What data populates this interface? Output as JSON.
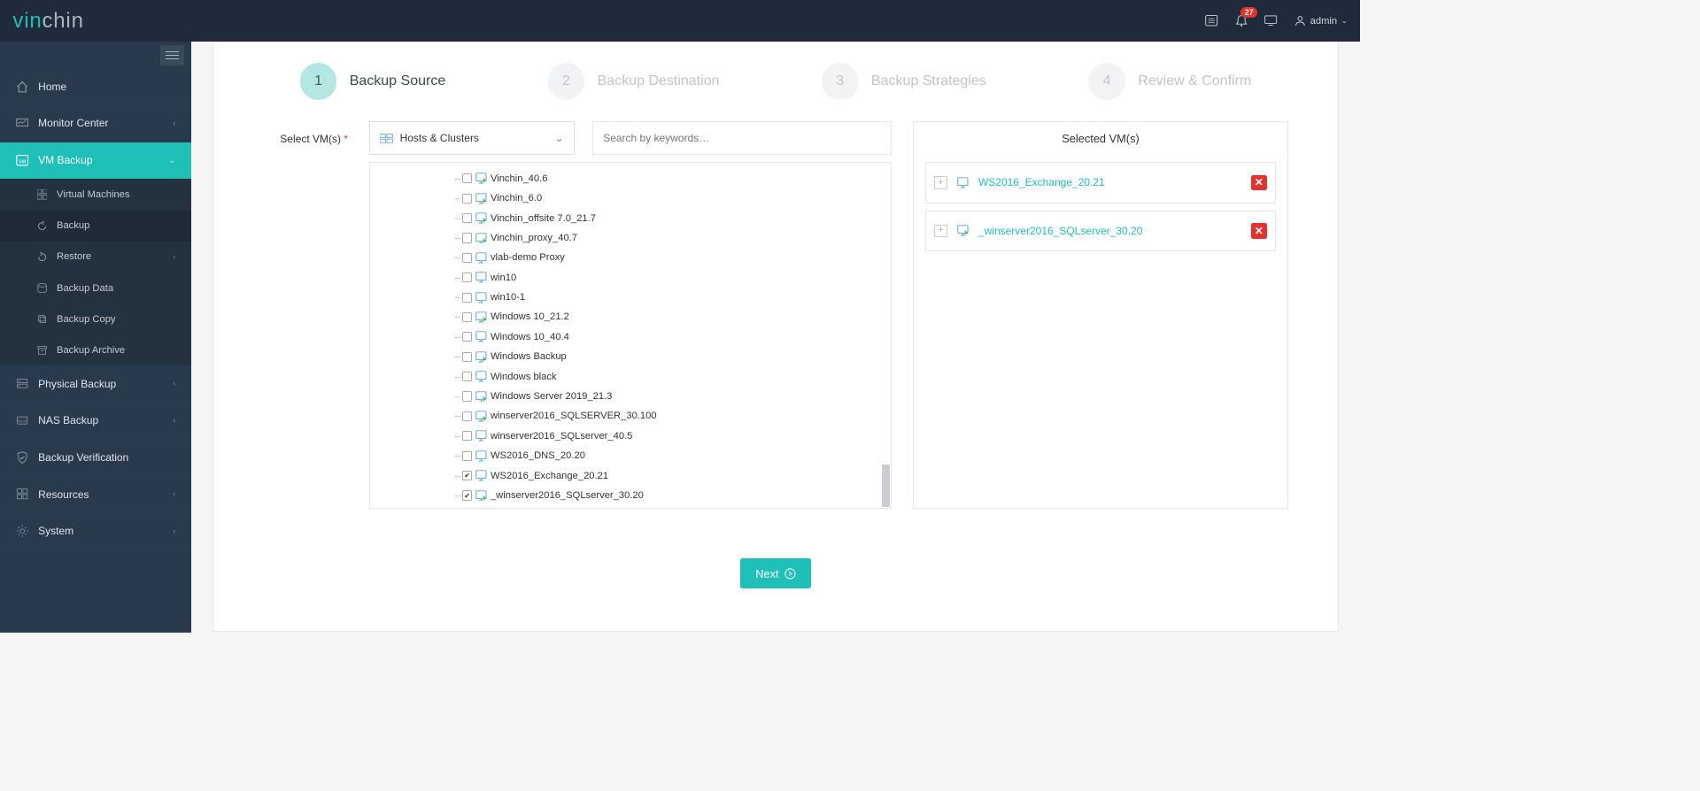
{
  "topbar": {
    "logo_prefix": "vin",
    "logo_suffix": "chin",
    "notification_count": "27",
    "user_label": "admin"
  },
  "sidebar": {
    "items": [
      {
        "label": "Home"
      },
      {
        "label": "Monitor Center"
      },
      {
        "label": "VM Backup"
      },
      {
        "label": "Physical Backup"
      },
      {
        "label": "NAS Backup"
      },
      {
        "label": "Backup Verification"
      },
      {
        "label": "Resources"
      },
      {
        "label": "System"
      }
    ],
    "vm_sub": [
      {
        "label": "Virtual Machines"
      },
      {
        "label": "Backup"
      },
      {
        "label": "Restore"
      },
      {
        "label": "Backup Data"
      },
      {
        "label": "Backup Copy"
      },
      {
        "label": "Backup Archive"
      }
    ]
  },
  "steps": [
    {
      "num": "1",
      "label": "Backup Source"
    },
    {
      "num": "2",
      "label": "Backup Destination"
    },
    {
      "num": "3",
      "label": "Backup Strategies"
    },
    {
      "num": "4",
      "label": "Review & Confirm"
    }
  ],
  "source": {
    "label": "Select VM(s)",
    "filter_label": "Hosts & Clusters",
    "search_placeholder": "Search by keywords…"
  },
  "tree": [
    {
      "label": "Vinchin_40.6",
      "checked": false,
      "green": true
    },
    {
      "label": "Vinchin_6.0",
      "checked": false,
      "green": true
    },
    {
      "label": "Vinchin_offsite 7.0_21.7",
      "checked": false,
      "green": true
    },
    {
      "label": "Vinchin_proxy_40.7",
      "checked": false,
      "green": true
    },
    {
      "label": "vlab-demo Proxy",
      "checked": false,
      "green": false
    },
    {
      "label": "win10",
      "checked": false,
      "green": false
    },
    {
      "label": "win10-1",
      "checked": false,
      "green": false
    },
    {
      "label": "Windows 10_21.2",
      "checked": false,
      "green": true
    },
    {
      "label": "Windows 10_40.4",
      "checked": false,
      "green": false
    },
    {
      "label": "Windows Backup",
      "checked": false,
      "green": true
    },
    {
      "label": "Windows black",
      "checked": false,
      "green": false
    },
    {
      "label": "Windows Server 2019_21.3",
      "checked": false,
      "green": true
    },
    {
      "label": "winserver2016_SQLSERVER_30.100",
      "checked": false,
      "green": true
    },
    {
      "label": "winserver2016_SQLserver_40.5",
      "checked": false,
      "green": false
    },
    {
      "label": "WS2016_DNS_20.20",
      "checked": false,
      "green": false
    },
    {
      "label": "WS2016_Exchange_20.21",
      "checked": true,
      "green": false
    },
    {
      "label": "_winserver2016_SQLserver_30.20",
      "checked": true,
      "green": true
    }
  ],
  "selected": {
    "header": "Selected VM(s)",
    "items": [
      {
        "label": "WS2016_Exchange_20.21",
        "green": false
      },
      {
        "label": "_winserver2016_SQLserver_30.20",
        "green": true
      }
    ]
  },
  "next_label": "Next"
}
